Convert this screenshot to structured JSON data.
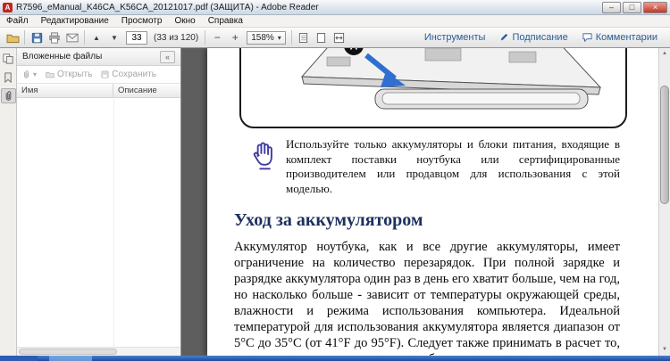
{
  "window": {
    "title": "R7596_eManual_K46CA_K56CA_20121017.pdf (ЗАЩИТА) - Adobe Reader",
    "minimize": "–",
    "maximize": "□",
    "close": "×"
  },
  "menu": {
    "items": [
      "Файл",
      "Редактирование",
      "Просмотр",
      "Окно",
      "Справка"
    ]
  },
  "toolbar": {
    "page_number": "33",
    "page_count": "(33 из 120)",
    "zoom": "158%",
    "tools": "Инструменты",
    "sign": "Подписание",
    "comments": "Комментарии"
  },
  "icons": {
    "prev": "▲",
    "next": "▼",
    "zoom_out": "−",
    "zoom_in": "+",
    "caret": "▾",
    "collapse": "«",
    "scroll_up": "▲",
    "scroll_down": "▼"
  },
  "sidebar": {
    "title": "Вложенные файлы",
    "open": "Открыть",
    "save": "Сохранить",
    "col_name": "Имя",
    "col_desc": "Описание"
  },
  "document": {
    "callout": "A",
    "warning": "Используйте только аккумуляторы и блоки питания, входящие в комплект поставки ноутбука или сертифицированные производителем или продавцом для использования с этой моделью.",
    "heading": "Уход за аккумулятором",
    "body": "Аккумулятор ноутбука, как и все другие аккумуляторы, имеет ограничение на количество перезарядок. При полной зарядке и разрядке аккумулятора один раз в день его хватит больше, чем на год, но насколько больше - зависит от температуры окружающей среды, влажности и режима использования компьютера. Идеальной температурой для использования аккумулятора является диапазон от 5°C до 35°C (от 41°F до 95°F). Следует также принимать в расчет то, что внутренняя температура в ноутбуке выше, чем внешняя."
  },
  "colors": {
    "accent_blue": "#2b5d96",
    "heading": "#1c2f5e",
    "doc_background": "#5e5e5e"
  }
}
